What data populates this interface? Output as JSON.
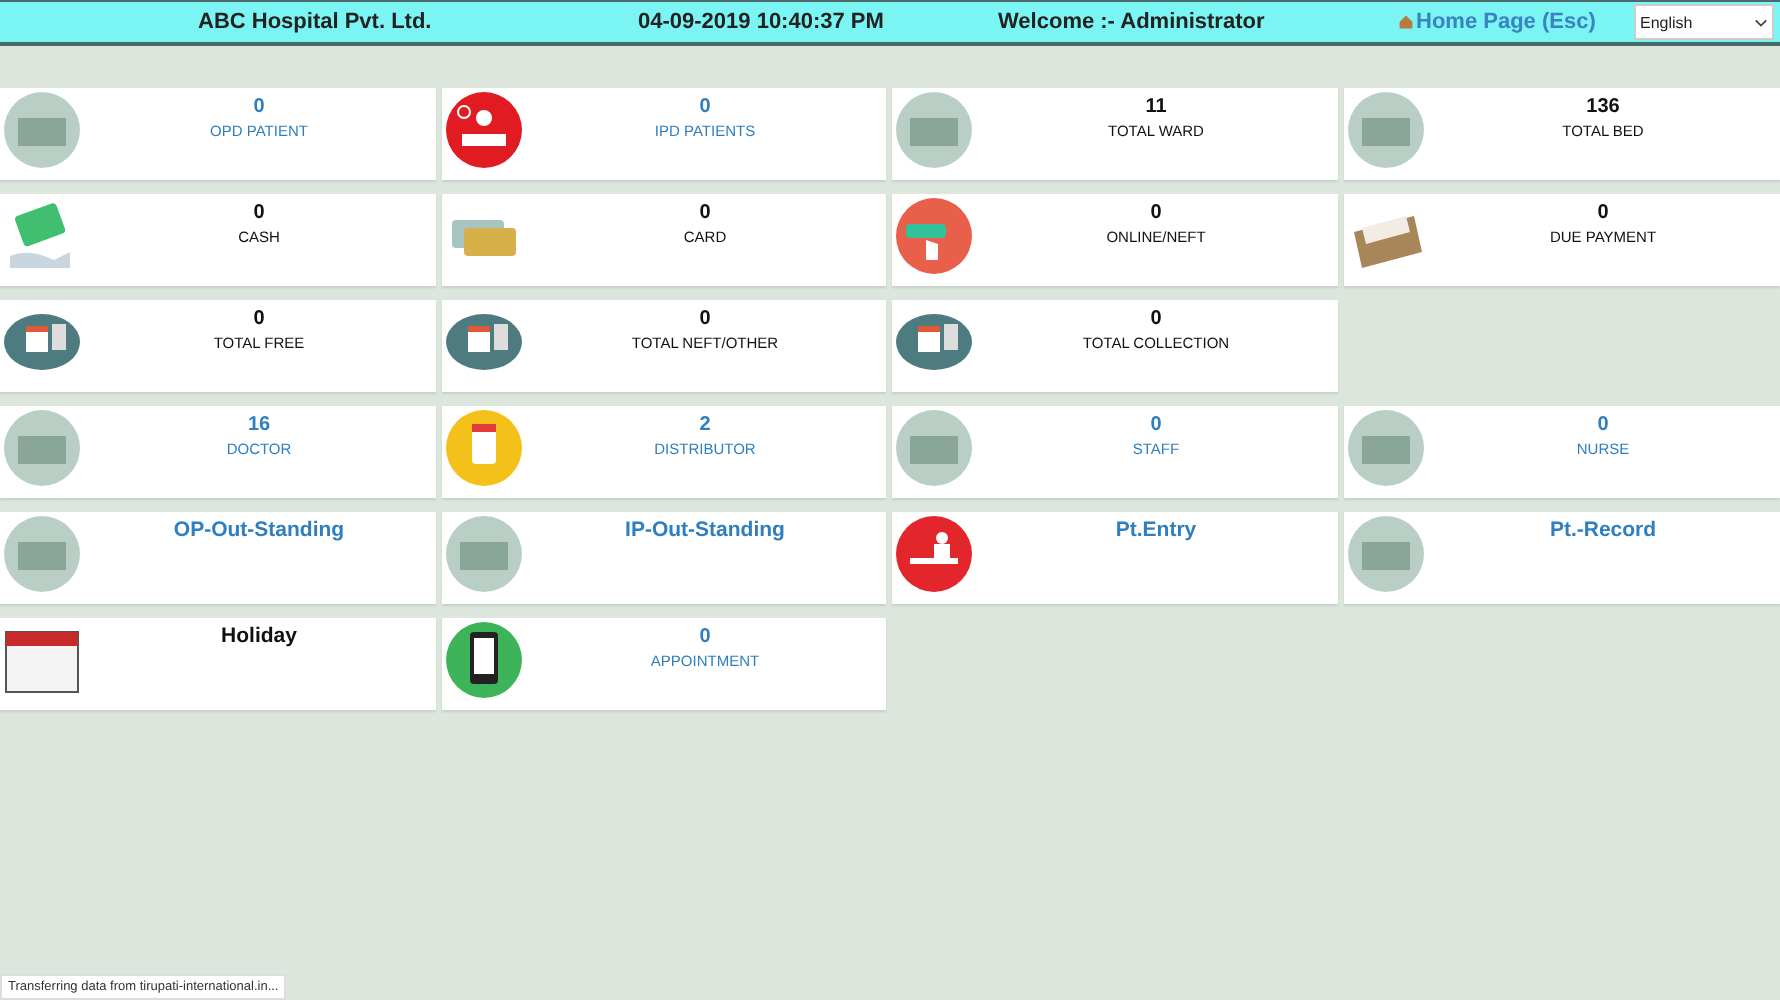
{
  "header": {
    "hospital": "ABC Hospital Pvt. Ltd.",
    "datetime": "04-09-2019 10:40:37 PM",
    "welcome": "Welcome :- Administrator",
    "home_link": "Home Page (Esc)",
    "language": "English"
  },
  "rows": [
    [
      {
        "kind": "stat",
        "color": "#2f7fbf",
        "value": "0",
        "label": "OPD PATIENT"
      },
      {
        "kind": "stat",
        "color": "#2f7fbf",
        "value": "0",
        "label": "IPD PATIENTS"
      },
      {
        "kind": "stat",
        "color": "#111111",
        "value": "11",
        "label": "TOTAL WARD"
      },
      {
        "kind": "stat",
        "color": "#111111",
        "value": "136",
        "label": "TOTAL BED"
      }
    ],
    [
      {
        "kind": "stat",
        "color": "#111111",
        "value": "0",
        "label": "CASH"
      },
      {
        "kind": "stat",
        "color": "#111111",
        "value": "0",
        "label": "CARD"
      },
      {
        "kind": "stat",
        "color": "#111111",
        "value": "0",
        "label": "ONLINE/NEFT"
      },
      {
        "kind": "stat",
        "color": "#111111",
        "value": "0",
        "label": "DUE PAYMENT"
      }
    ],
    [
      {
        "kind": "stat",
        "color": "#111111",
        "value": "0",
        "label": "TOTAL FREE"
      },
      {
        "kind": "stat",
        "color": "#111111",
        "value": "0",
        "label": "TOTAL NEFT/OTHER"
      },
      {
        "kind": "stat",
        "color": "#111111",
        "value": "0",
        "label": "TOTAL COLLECTION"
      }
    ],
    [
      {
        "kind": "stat",
        "color": "#2f7fbf",
        "value": "16",
        "label": "DOCTOR"
      },
      {
        "kind": "stat",
        "color": "#2f7fbf",
        "value": "2",
        "label": "DISTRIBUTOR"
      },
      {
        "kind": "stat",
        "color": "#2f7fbf",
        "value": "0",
        "label": "STAFF"
      },
      {
        "kind": "stat",
        "color": "#2f7fbf",
        "value": "0",
        "label": "NURSE"
      }
    ],
    [
      {
        "kind": "link",
        "color": "#2f7fbf",
        "title": "OP-Out-Standing"
      },
      {
        "kind": "link",
        "color": "#2f7fbf",
        "title": "IP-Out-Standing"
      },
      {
        "kind": "link",
        "color": "#2f7fbf",
        "title": "Pt.Entry"
      },
      {
        "kind": "link",
        "color": "#2f7fbf",
        "title": "Pt.-Record"
      }
    ],
    [
      {
        "kind": "link",
        "color": "#111111",
        "title": "Holiday"
      },
      {
        "kind": "stat",
        "color": "#2f7fbf",
        "value": "0",
        "label": "APPOINTMENT"
      }
    ]
  ],
  "status_bar": "Transferring data from tirupati-international.in..."
}
